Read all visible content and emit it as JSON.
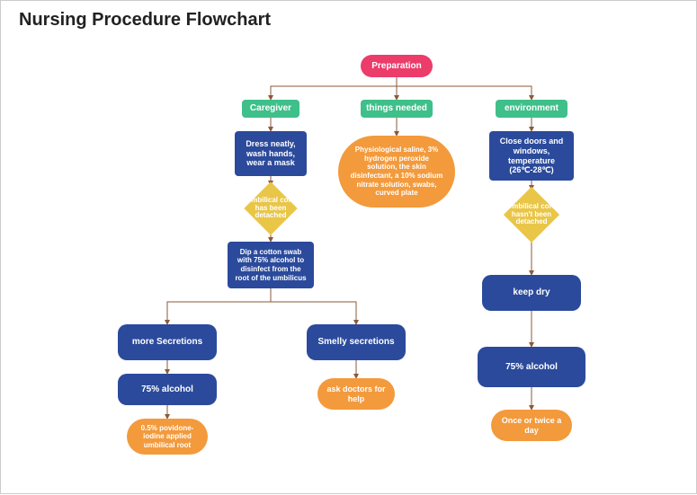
{
  "title": "Nursing Procedure Flowchart",
  "chart_data": {
    "type": "flowchart",
    "title": "Nursing Procedure Flowchart",
    "nodes": [
      {
        "id": "prep",
        "shape": "pill",
        "color": "pink",
        "text": "Preparation"
      },
      {
        "id": "caregiver",
        "shape": "rect",
        "color": "green",
        "text": "Caregiver"
      },
      {
        "id": "things",
        "shape": "rect",
        "color": "green",
        "text": "things needed"
      },
      {
        "id": "env",
        "shape": "rect",
        "color": "green",
        "text": "environment"
      },
      {
        "id": "dress",
        "shape": "rect",
        "color": "blue",
        "text": "Dress neatly, wash  hands, wear a mask"
      },
      {
        "id": "supplies",
        "shape": "pill",
        "color": "orange",
        "text": "Physiological saline, 3% hydrogen peroxide solution, the skin disinfectant, a 10% sodium nitrate solution, swabs, curved plate"
      },
      {
        "id": "close",
        "shape": "rect",
        "color": "blue",
        "text": "Close doors and windows, temperature (26℃-28℃)"
      },
      {
        "id": "d1",
        "shape": "diamond",
        "color": "yellow",
        "text": "Umbilical cord has been detached"
      },
      {
        "id": "d2",
        "shape": "diamond",
        "color": "yellow",
        "text": "Umbilical cord hasn't been detached"
      },
      {
        "id": "dip",
        "shape": "rect",
        "color": "blue",
        "text": "Dip a cotton swab with 75% alcohol to disinfect from the root of the umbilicus"
      },
      {
        "id": "more",
        "shape": "rrect",
        "color": "blue",
        "text": "more Secretions"
      },
      {
        "id": "smelly",
        "shape": "rrect",
        "color": "blue",
        "text": "Smelly secretions"
      },
      {
        "id": "alc1",
        "shape": "rrect",
        "color": "blue",
        "text": "75% alcohol"
      },
      {
        "id": "ask",
        "shape": "pill",
        "color": "orange",
        "text": "ask doctors for help"
      },
      {
        "id": "iodine",
        "shape": "pill",
        "color": "orange",
        "text": "0.5% povidone-iodine applied umbilical root"
      },
      {
        "id": "keepdry",
        "shape": "rrect",
        "color": "blue",
        "text": "keep dry"
      },
      {
        "id": "alc2",
        "shape": "rrect",
        "color": "blue",
        "text": "75% alcohol"
      },
      {
        "id": "once",
        "shape": "pill",
        "color": "orange",
        "text": "Once or twice a day"
      }
    ],
    "edges": [
      [
        "prep",
        "caregiver"
      ],
      [
        "prep",
        "things"
      ],
      [
        "prep",
        "env"
      ],
      [
        "caregiver",
        "dress"
      ],
      [
        "things",
        "supplies"
      ],
      [
        "env",
        "close"
      ],
      [
        "dress",
        "d1"
      ],
      [
        "close",
        "d2"
      ],
      [
        "d1",
        "dip"
      ],
      [
        "dip",
        "more"
      ],
      [
        "dip",
        "smelly"
      ],
      [
        "more",
        "alc1"
      ],
      [
        "alc1",
        "iodine"
      ],
      [
        "smelly",
        "ask"
      ],
      [
        "d2",
        "keepdry"
      ],
      [
        "keepdry",
        "alc2"
      ],
      [
        "alc2",
        "once"
      ]
    ]
  }
}
